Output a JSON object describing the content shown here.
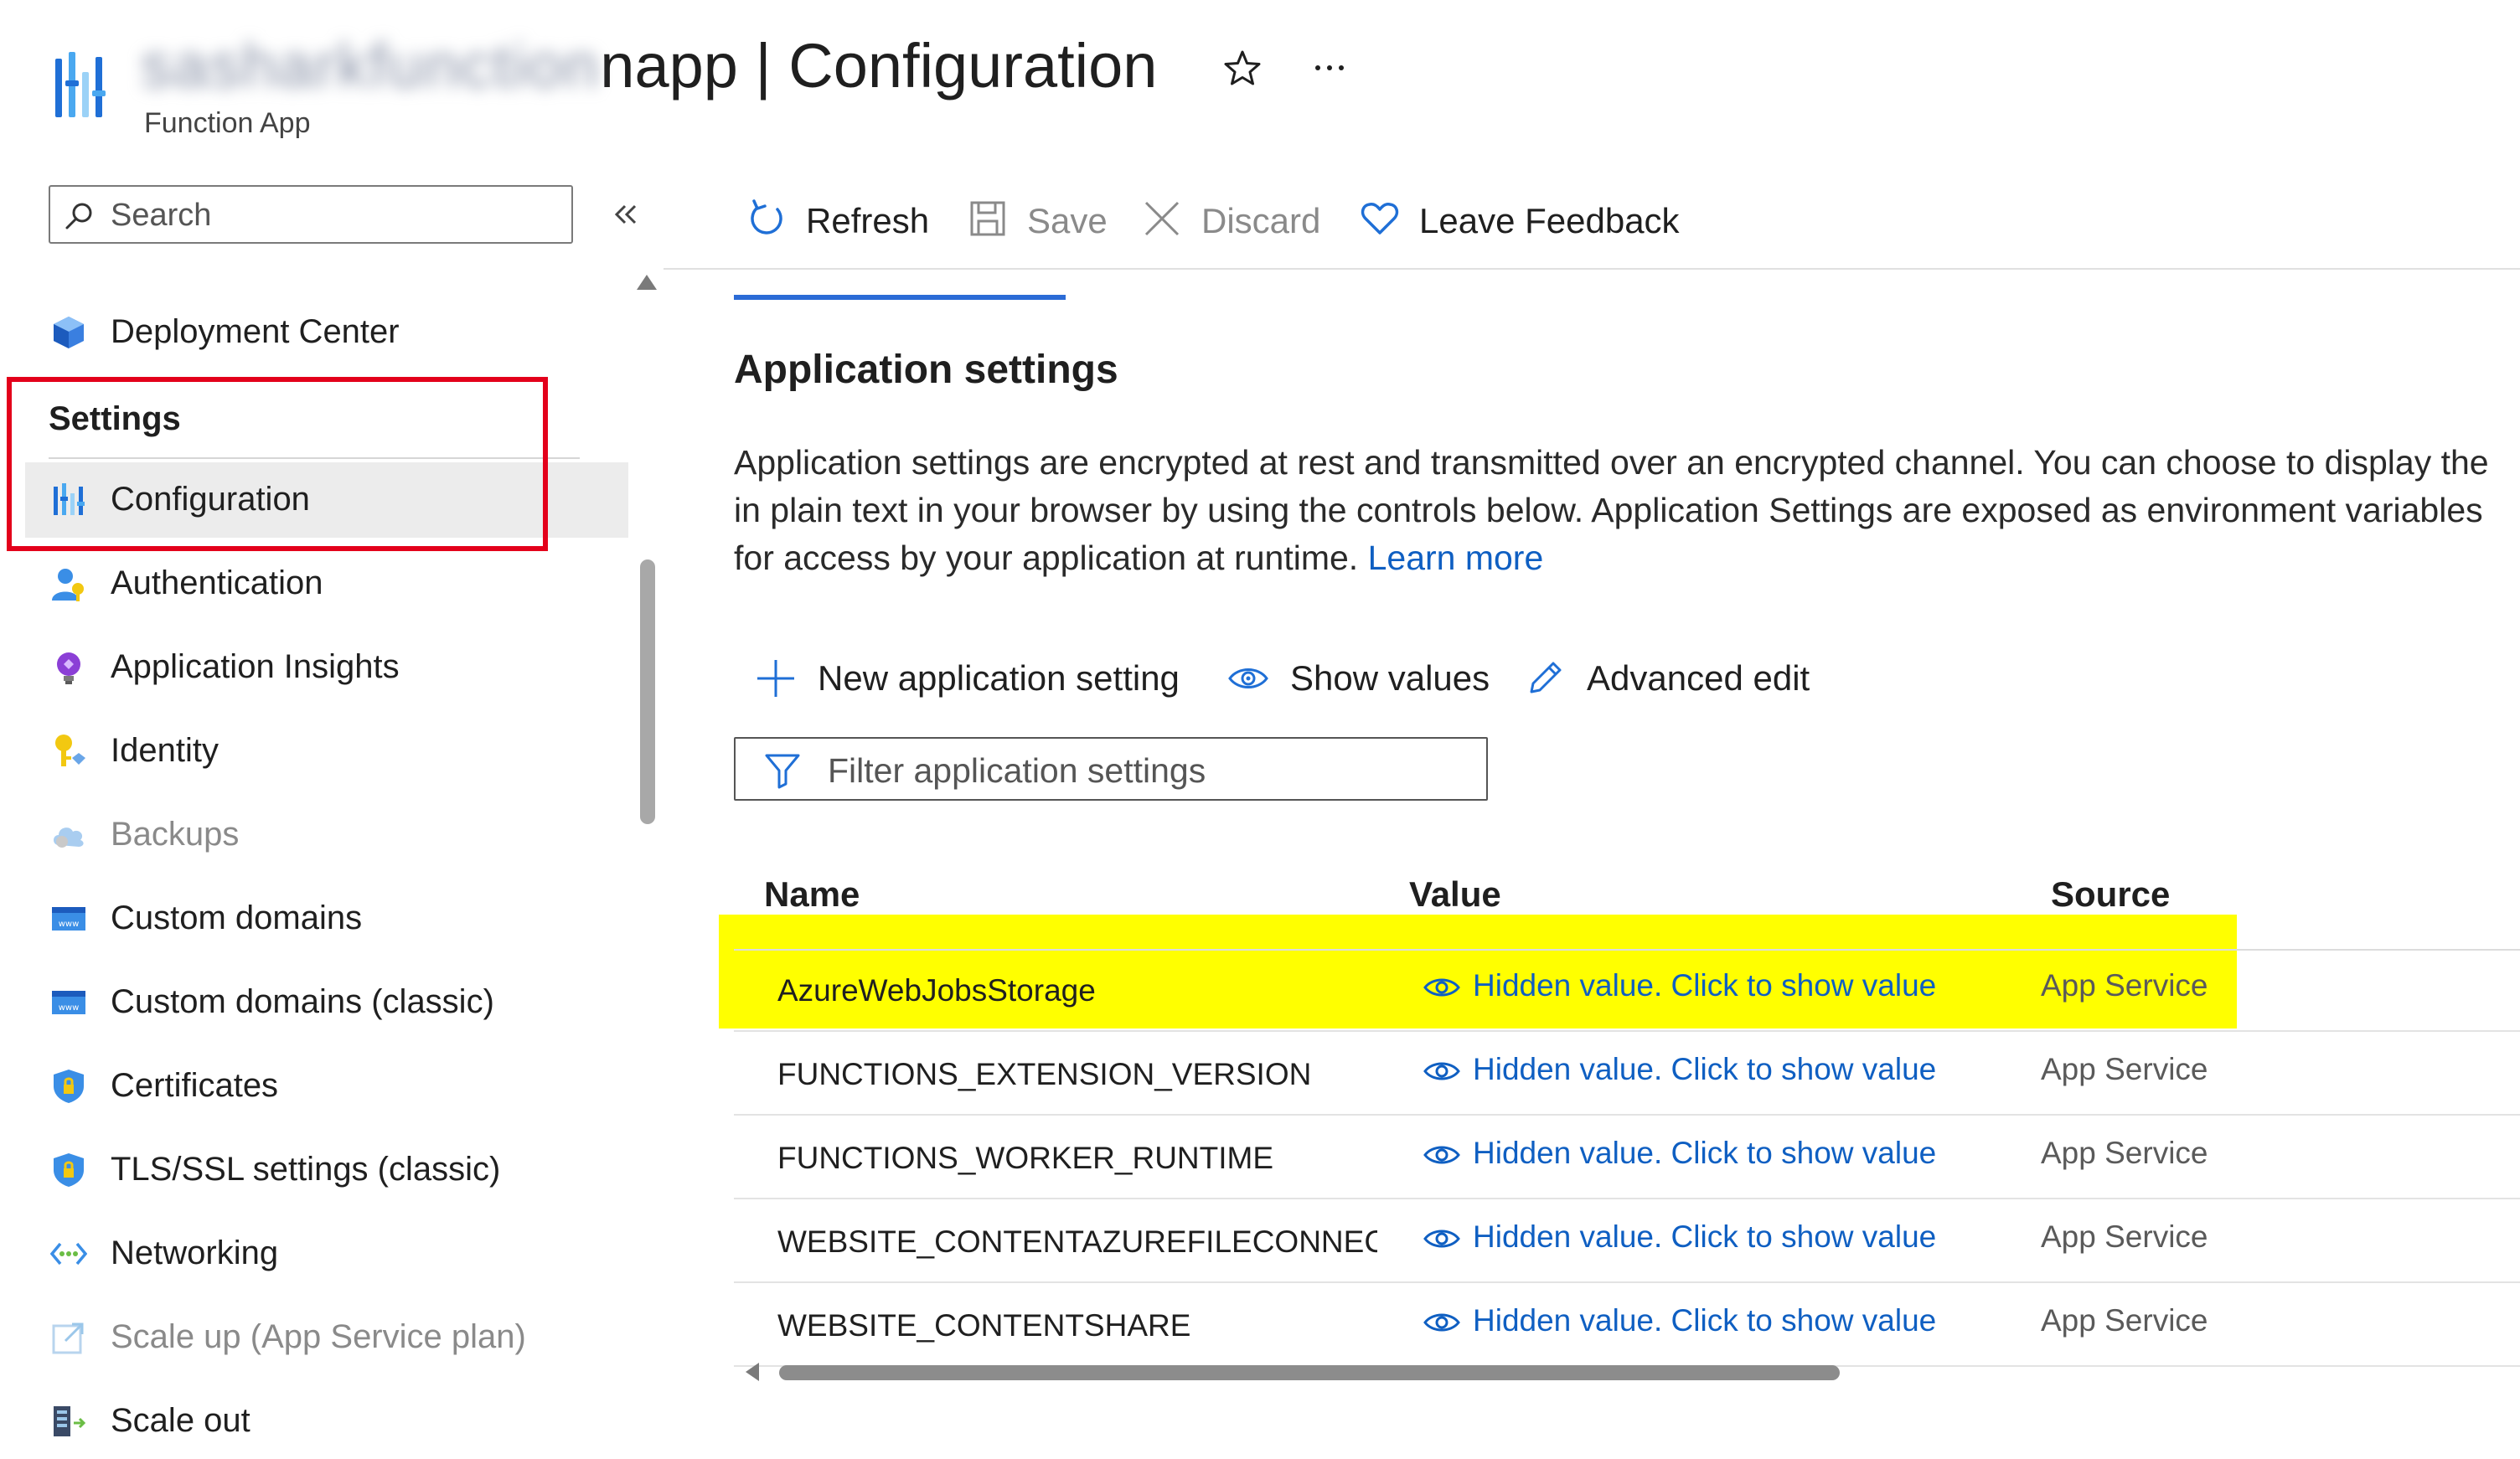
{
  "header": {
    "title_blurred": "sasharkfunction",
    "title_visible": "napp | Configuration",
    "subtitle": "Function App"
  },
  "sidebar": {
    "search_placeholder": "Search",
    "settings_header": "Settings",
    "items": [
      {
        "label": "Deployment Center",
        "icon": "deployment-center-icon",
        "state": "normal"
      },
      {
        "label": "Configuration",
        "icon": "configuration-icon",
        "state": "selected"
      },
      {
        "label": "Authentication",
        "icon": "authentication-icon",
        "state": "normal"
      },
      {
        "label": "Application Insights",
        "icon": "application-insights-icon",
        "state": "normal"
      },
      {
        "label": "Identity",
        "icon": "identity-icon",
        "state": "normal"
      },
      {
        "label": "Backups",
        "icon": "backups-icon",
        "state": "disabled"
      },
      {
        "label": "Custom domains",
        "icon": "custom-domains-icon",
        "state": "normal"
      },
      {
        "label": "Custom domains (classic)",
        "icon": "custom-domains-classic-icon",
        "state": "normal"
      },
      {
        "label": "Certificates",
        "icon": "certificates-icon",
        "state": "normal"
      },
      {
        "label": "TLS/SSL settings (classic)",
        "icon": "tls-ssl-icon",
        "state": "normal"
      },
      {
        "label": "Networking",
        "icon": "networking-icon",
        "state": "normal"
      },
      {
        "label": "Scale up (App Service plan)",
        "icon": "scale-up-icon",
        "state": "disabled"
      },
      {
        "label": "Scale out",
        "icon": "scale-out-icon",
        "state": "normal"
      }
    ]
  },
  "toolbar": {
    "refresh": "Refresh",
    "save": "Save",
    "discard": "Discard",
    "feedback": "Leave Feedback"
  },
  "main": {
    "section_title": "Application settings",
    "description_line1": "Application settings are encrypted at rest and transmitted over an encrypted channel. You can choose to display the",
    "description_line2": "in plain text in your browser by using the controls below. Application Settings are exposed as environment variables",
    "description_line3": "for access by your application at runtime.",
    "learn_more": "Learn more",
    "actions": {
      "new_setting": "New application setting",
      "show_values": "Show values",
      "advanced_edit": "Advanced edit"
    },
    "filter_placeholder": "Filter application settings",
    "table": {
      "columns": [
        "Name",
        "Value",
        "Source"
      ],
      "rows": [
        {
          "name": "AzureWebJobsStorage",
          "value": "Hidden value. Click to show value",
          "source": "App Service"
        },
        {
          "name": "FUNCTIONS_EXTENSION_VERSION",
          "value": "Hidden value. Click to show value",
          "source": "App Service"
        },
        {
          "name": "FUNCTIONS_WORKER_RUNTIME",
          "value": "Hidden value. Click to show value",
          "source": "App Service"
        },
        {
          "name": "WEBSITE_CONTENTAZUREFILECONNECTIONSTRING",
          "value": "Hidden value. Click to show value",
          "source": "App Service"
        },
        {
          "name": "WEBSITE_CONTENTSHARE",
          "value": "Hidden value. Click to show value",
          "source": "App Service"
        }
      ]
    }
  },
  "colors": {
    "accent": "#2b6bd6",
    "link": "#0f5fc2",
    "highlight_yellow": "#ffff00",
    "highlight_red": "#e3001b"
  }
}
